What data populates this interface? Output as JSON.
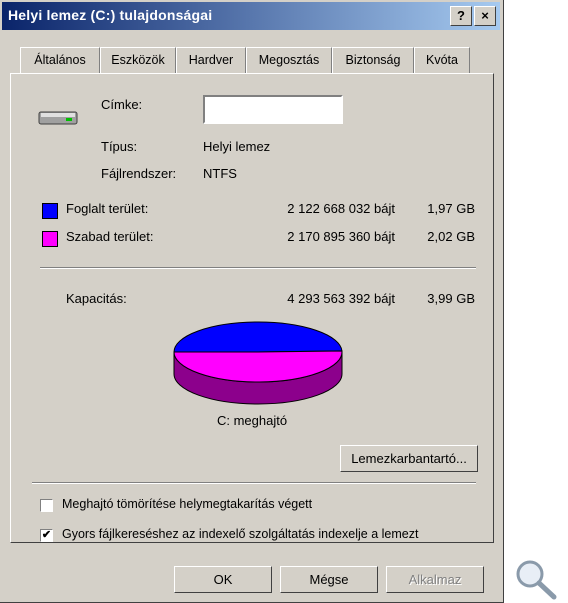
{
  "window": {
    "title": "Helyi lemez (C:) tulajdonságai",
    "help_glyph": "?",
    "close_glyph": "×"
  },
  "tabs": [
    {
      "label": "Általános",
      "active": true
    },
    {
      "label": "Eszközök"
    },
    {
      "label": "Hardver"
    },
    {
      "label": "Megosztás"
    },
    {
      "label": "Biztonság"
    },
    {
      "label": "Kvóta"
    }
  ],
  "general": {
    "label_caption": "Címke:",
    "label_value": "",
    "type_caption": "Típus:",
    "type_value": "Helyi lemez",
    "fs_caption": "Fájlrendszer:",
    "fs_value": "NTFS",
    "used": {
      "caption": "Foglalt terület:",
      "bytes": "2 122 668 032 bájt",
      "size": "1,97 GB",
      "color": "#0000ff"
    },
    "free": {
      "caption": "Szabad terület:",
      "bytes": "2 170 895 360 bájt",
      "size": "2,02 GB",
      "color": "#ff00ff"
    },
    "capacity": {
      "caption": "Kapacitás:",
      "bytes": "4 293 563 392 bájt",
      "size": "3,99 GB"
    },
    "drive_label": "C: meghajtó",
    "cleanup_button": "Lemezkarbantartó...",
    "compress_option": {
      "label": "Meghajtó tömörítése helymegtakarítás végett",
      "checked": false
    },
    "index_option": {
      "label": "Gyors fájlkereséshez az indexelő szolgáltatás indexelje a lemezt",
      "checked": true,
      "check_glyph": "✔"
    }
  },
  "chart_data": {
    "type": "pie",
    "labels": [
      "Foglalt terület",
      "Szabad terület"
    ],
    "values": [
      2122668032,
      2170895360
    ],
    "colors": [
      "#0000ff",
      "#ff00ff"
    ],
    "xlabel": "C: meghajtó"
  },
  "footer": {
    "ok": "OK",
    "cancel": "Mégse",
    "apply": "Alkalmaz"
  },
  "icons": [
    "drive-icon",
    "help-icon",
    "close-icon",
    "magnifier-icon"
  ]
}
